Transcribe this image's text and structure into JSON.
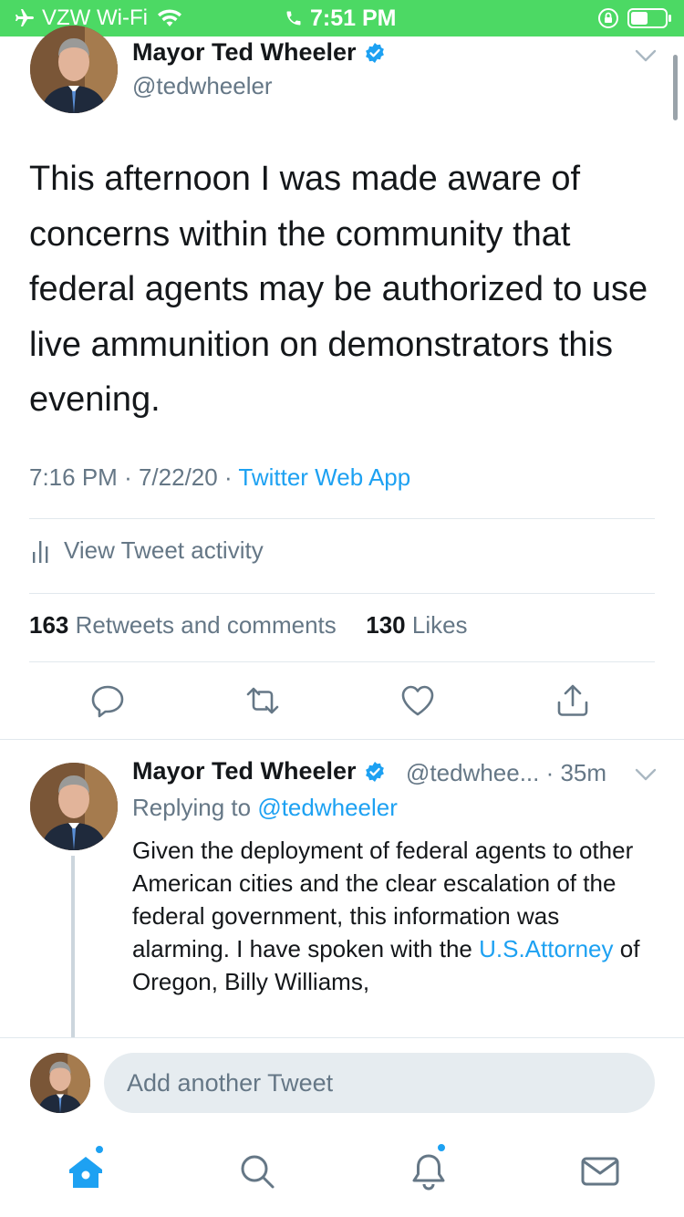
{
  "status_bar": {
    "carrier": "VZW Wi-Fi",
    "time": "7:51 PM"
  },
  "tweet": {
    "author_name": "Mayor Ted Wheeler",
    "author_handle": "@tedwheeler",
    "text": "This afternoon I was made aware of concerns within the community that federal agents may be authorized to use live ammunition on demonstrators this evening.",
    "time": "7:16 PM",
    "date": "7/22/20",
    "source": "Twitter Web App",
    "separator": "·",
    "activity_label": "View Tweet activity",
    "retweets_count": "163",
    "retweets_label": "Retweets and comments",
    "likes_count": "130",
    "likes_label": "Likes"
  },
  "reply": {
    "author_name": "Mayor Ted Wheeler",
    "handle_time": "@tedwhee... · 35m",
    "replying_prefix": "Replying to",
    "replying_to": "@tedwheeler",
    "text_before_link": "Given the deployment of federal agents to other American cities and the clear escalation of the federal government, this information was alarming. I have spoken with the ",
    "link_text": "U.S.Attorney",
    "text_after_link": " of Oregon, Billy Williams,"
  },
  "compose": {
    "placeholder": "Add another Tweet"
  },
  "colors": {
    "status_bar": "#4cd964",
    "accent": "#1da1f2",
    "secondary_text": "#657786"
  },
  "tabs": [
    "home-icon",
    "search-icon",
    "notifications-icon",
    "messages-icon"
  ]
}
